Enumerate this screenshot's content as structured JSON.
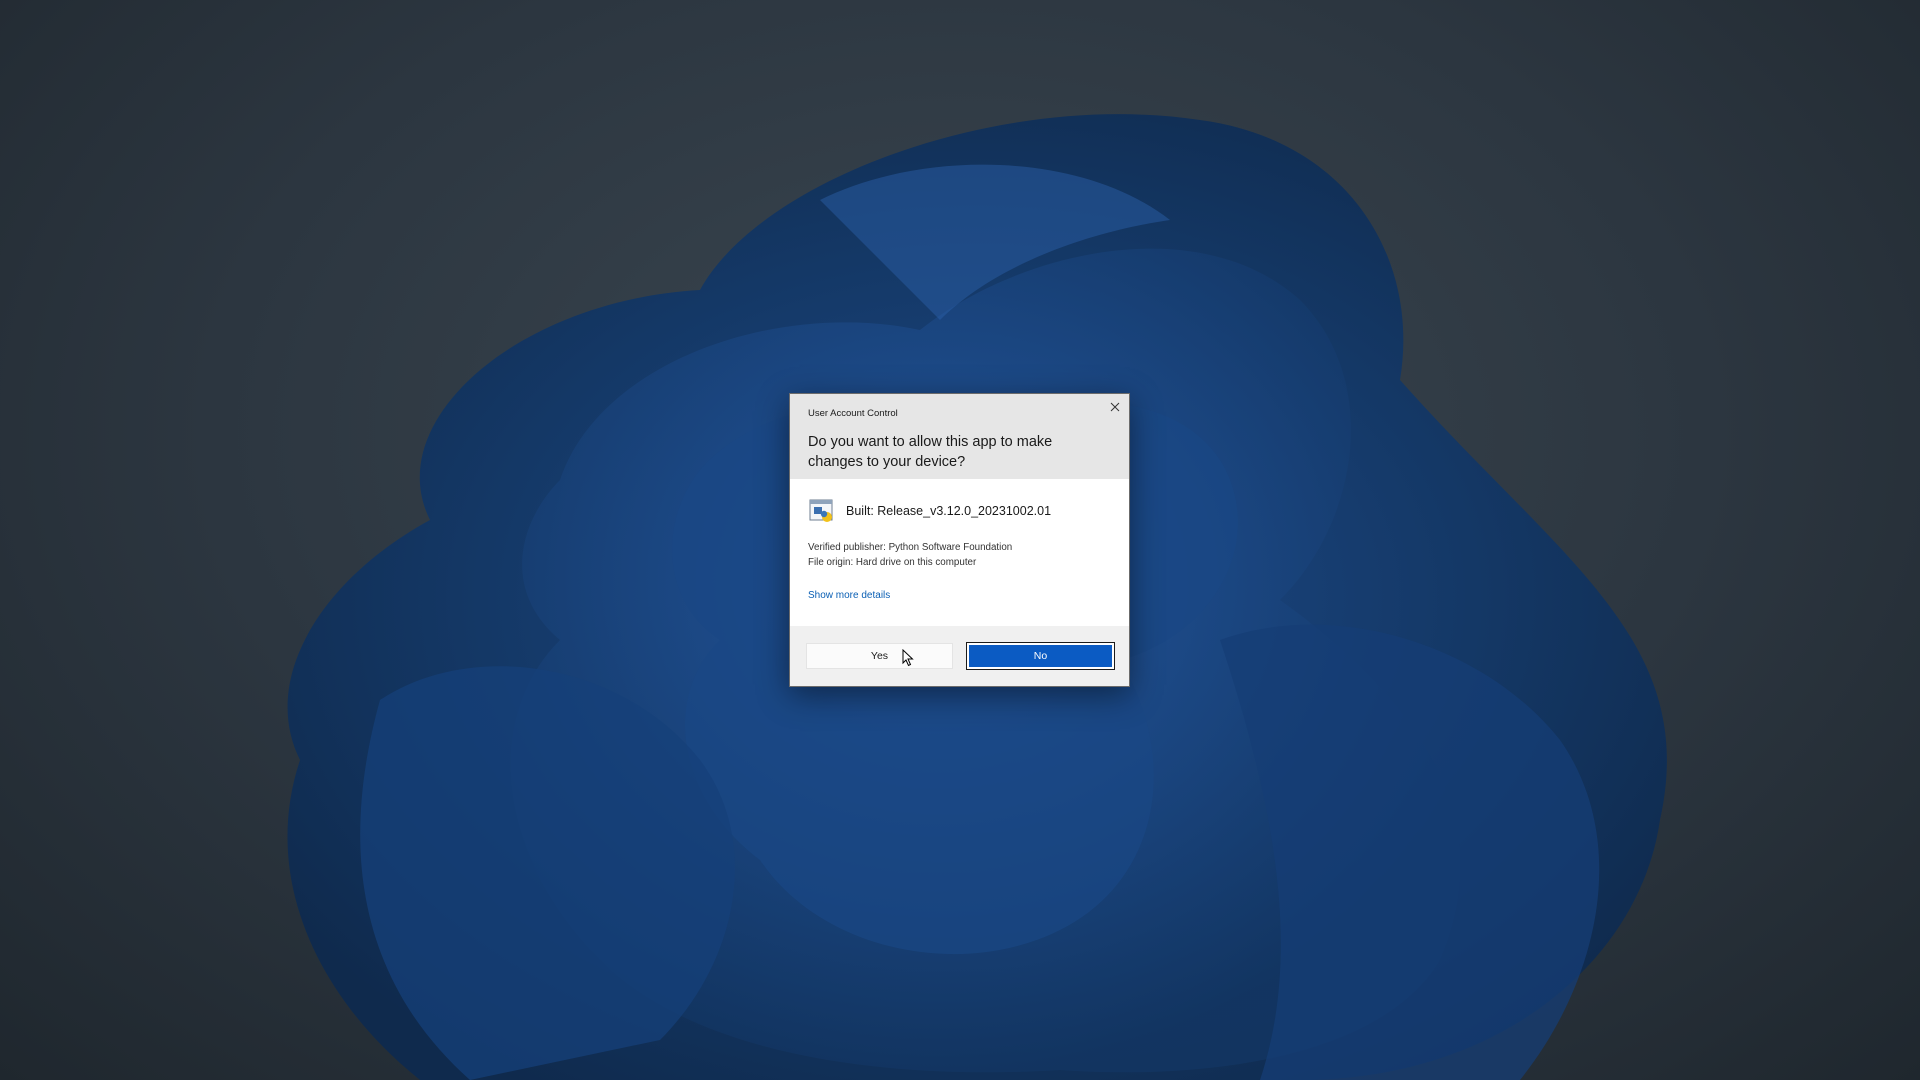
{
  "dialog": {
    "title": "User Account Control",
    "question": "Do you want to allow this app to make changes to your device?",
    "app_name": "Built: Release_v3.12.0_20231002.01",
    "publisher": "Verified publisher: Python Software Foundation",
    "origin": "File origin: Hard drive on this computer",
    "more_details_link": "Show more details",
    "yes_label": "Yes",
    "no_label": "No"
  },
  "icons": {
    "close": "close-icon",
    "app": "python-installer-icon",
    "cursor": "mouse-cursor-icon"
  },
  "colors": {
    "primary_button": "#0b5bc3",
    "link": "#0a5fb4",
    "header_bg": "#e6e6e6",
    "footer_bg": "#f0f0f0"
  }
}
